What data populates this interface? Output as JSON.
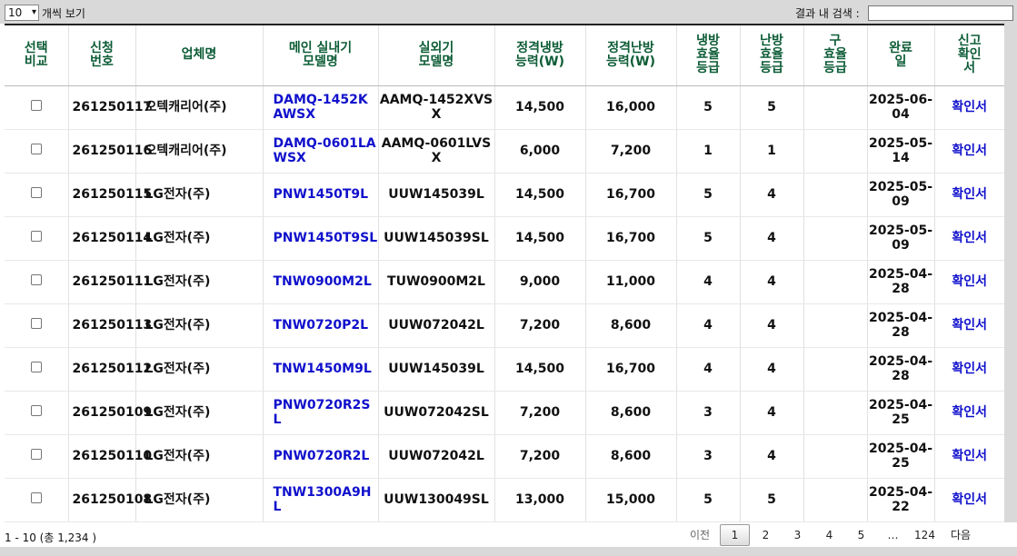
{
  "toolbar": {
    "length_value": "10",
    "length_label": "개씩 보기",
    "search_label": "결과 내 검색 :",
    "search_value": ""
  },
  "columns": [
    "선택\n비교",
    "신청\n번호",
    "업체명",
    "메인 실내기\n모델명",
    "실외기\n모델명",
    "정격냉방\n능력(W)",
    "정격난방\n능력(W)",
    "냉방\n효율\n등급",
    "난방\n효율\n등급",
    "구\n효율\n등급",
    "완료\n일",
    "신고\n확인\n서"
  ],
  "rows": [
    {
      "no": "261250117",
      "firm": "오텍캐리어(주)",
      "indoor": "DAMQ-1452KAWSX",
      "outdoor": "AAMQ-1452XVSX",
      "cool": "14,500",
      "heat": "16,000",
      "cool_grade": "5",
      "heat_grade": "5",
      "old_grade": "",
      "date": "2025-06-04",
      "cert": "확인서"
    },
    {
      "no": "261250116",
      "firm": "오텍캐리어(주)",
      "indoor": "DAMQ-0601LAWSX",
      "outdoor": "AAMQ-0601LVSX",
      "cool": "6,000",
      "heat": "7,200",
      "cool_grade": "1",
      "heat_grade": "1",
      "old_grade": "",
      "date": "2025-05-14",
      "cert": "확인서"
    },
    {
      "no": "261250115",
      "firm": "LG전자(주)",
      "indoor": "PNW1450T9L",
      "outdoor": "UUW145039L",
      "cool": "14,500",
      "heat": "16,700",
      "cool_grade": "5",
      "heat_grade": "4",
      "old_grade": "",
      "date": "2025-05-09",
      "cert": "확인서"
    },
    {
      "no": "261250114",
      "firm": "LG전자(주)",
      "indoor": "PNW1450T9SL",
      "outdoor": "UUW145039SL",
      "cool": "14,500",
      "heat": "16,700",
      "cool_grade": "5",
      "heat_grade": "4",
      "old_grade": "",
      "date": "2025-05-09",
      "cert": "확인서"
    },
    {
      "no": "261250111",
      "firm": "LG전자(주)",
      "indoor": "TNW0900M2L",
      "outdoor": "TUW0900M2L",
      "cool": "9,000",
      "heat": "11,000",
      "cool_grade": "4",
      "heat_grade": "4",
      "old_grade": "",
      "date": "2025-04-28",
      "cert": "확인서"
    },
    {
      "no": "261250113",
      "firm": "LG전자(주)",
      "indoor": "TNW0720P2L",
      "outdoor": "UUW072042L",
      "cool": "7,200",
      "heat": "8,600",
      "cool_grade": "4",
      "heat_grade": "4",
      "old_grade": "",
      "date": "2025-04-28",
      "cert": "확인서"
    },
    {
      "no": "261250112",
      "firm": "LG전자(주)",
      "indoor": "TNW1450M9L",
      "outdoor": "UUW145039L",
      "cool": "14,500",
      "heat": "16,700",
      "cool_grade": "4",
      "heat_grade": "4",
      "old_grade": "",
      "date": "2025-04-28",
      "cert": "확인서"
    },
    {
      "no": "261250109",
      "firm": "LG전자(주)",
      "indoor": "PNW0720R2SL",
      "outdoor": "UUW072042SL",
      "cool": "7,200",
      "heat": "8,600",
      "cool_grade": "3",
      "heat_grade": "4",
      "old_grade": "",
      "date": "2025-04-25",
      "cert": "확인서"
    },
    {
      "no": "261250110",
      "firm": "LG전자(주)",
      "indoor": "PNW0720R2L",
      "outdoor": "UUW072042L",
      "cool": "7,200",
      "heat": "8,600",
      "cool_grade": "3",
      "heat_grade": "4",
      "old_grade": "",
      "date": "2025-04-25",
      "cert": "확인서"
    },
    {
      "no": "261250108",
      "firm": "LG전자(주)",
      "indoor": "TNW1300A9HL",
      "outdoor": "UUW130049SL",
      "cool": "13,000",
      "heat": "15,000",
      "cool_grade": "5",
      "heat_grade": "5",
      "old_grade": "",
      "date": "2025-04-22",
      "cert": "확인서"
    }
  ],
  "footer": {
    "info": "1 - 10 (총 1,234 )",
    "prev": "이전",
    "pages": [
      "1",
      "2",
      "3",
      "4",
      "5",
      "…",
      "124"
    ],
    "current_page": "1",
    "next": "다음"
  }
}
